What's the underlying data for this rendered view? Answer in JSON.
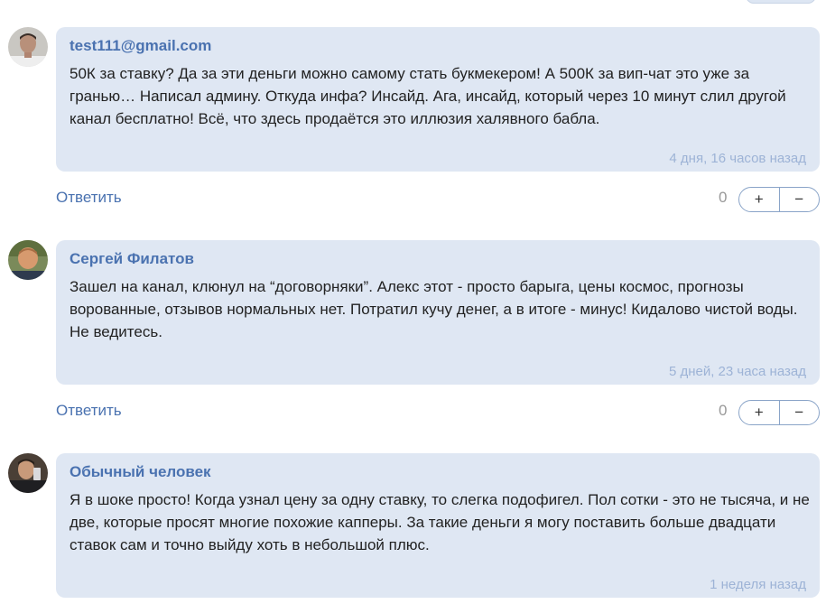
{
  "comments": [
    {
      "author": "test111@gmail.com",
      "text": "50К за ставку? Да за эти деньги можно самому стать букмекером! А 500К за вип-чат это уже за гранью… Написал админу. Откуда инфа? Инсайд. Ага, инсайд, который через 10 минут слил другой канал бесплатно! Всё, что здесь продаётся это иллюзия халявного бабла.",
      "time": "4 дня, 16 часов назад",
      "reply": "Ответить",
      "rating": "0",
      "upvote": "+",
      "downvote": "−"
    },
    {
      "author": "Сергей Филатов",
      "text": "Зашел на канал, клюнул на “договорняки”. Алекс этот - просто барыга, цены космос, прогнозы ворованные, отзывов нормальных нет. Потратил кучу денег, а в итоге - минус! Кидалово чистой воды. Не ведитесь.",
      "time": "5 дней, 23 часа назад",
      "reply": "Ответить",
      "rating": "0",
      "upvote": "+",
      "downvote": "−"
    },
    {
      "author": "Обычный человек",
      "text": "Я в шоке просто! Когда узнал цену за одну ставку, то слегка подофигел. Пол сотки - это не тысяча, и не две, которые просят многие похожие капперы. За такие деньги я могу поставить больше двадцати ставок сам и точно выйду хоть в небольшой плюс.",
      "time": "1 неделя назад"
    }
  ]
}
